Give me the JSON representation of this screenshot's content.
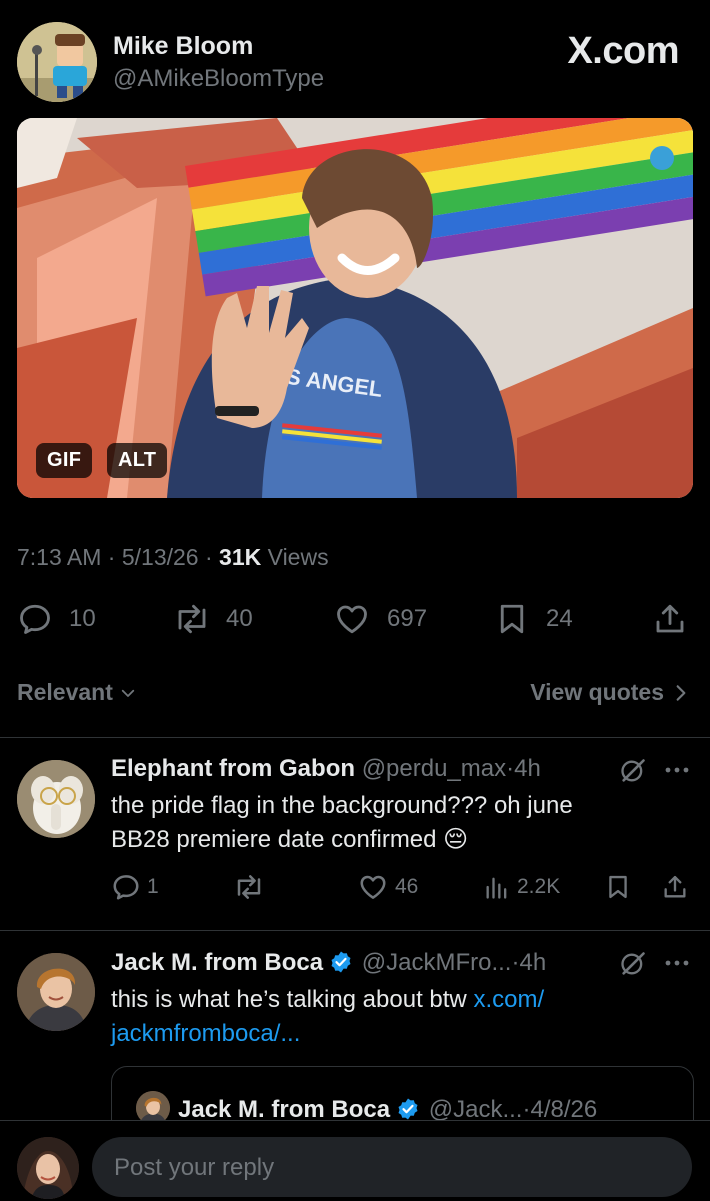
{
  "post": {
    "author_name": "Mike Bloom",
    "author_handle": "@AMikeBloomType",
    "site_label": "X.com",
    "media_badges": [
      "GIF",
      "ALT"
    ],
    "gif_shirt_text": "S ANGEL",
    "time": "7:13 AM",
    "date": "5/13/26",
    "views_count": "31K",
    "views_label": "Views",
    "separator": "·",
    "stats": {
      "replies": "10",
      "reposts": "40",
      "likes": "697",
      "bookmarks": "24"
    }
  },
  "filter": {
    "sort_label": "Relevant",
    "quotes_label": "View quotes"
  },
  "replies": [
    {
      "name": "Elephant from Gabon",
      "handle": "@perdu_max",
      "time": "4h",
      "text_line1": "the pride flag in the background??? oh june",
      "text_line2": "BB28 premiere date confirmed",
      "emoji": "😔",
      "stats": {
        "replies": "1",
        "likes": "46",
        "views": "2.2K"
      }
    },
    {
      "name": "Jack M. from Boca",
      "handle": "@JackMFro...",
      "time": "4h",
      "text_line1": "this is what he’s talking about btw",
      "link_line1": "x.com/",
      "link_line2": "jackmfromboca/...",
      "quote": {
        "name": "Jack M. from Boca",
        "handle": "@Jack...",
        "date": "4/8/26"
      }
    }
  ],
  "composer": {
    "placeholder": "Post your reply"
  },
  "colors": {
    "accent": "#1d9bf0",
    "muted": "#71767b",
    "divider": "#2f3336",
    "background": "#000000"
  }
}
